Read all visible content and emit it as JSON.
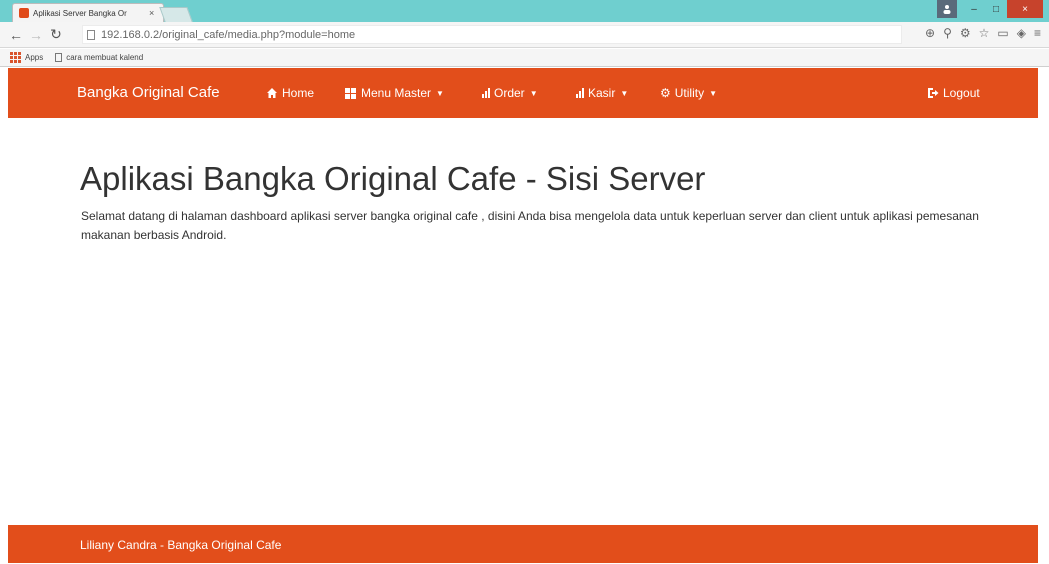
{
  "browser": {
    "tab_title": "Aplikasi Server Bangka Or",
    "tab_close": "×",
    "url": "192.168.0.2/original_cafe/media.php?module=home",
    "win_minimize": "–",
    "win_maximize": "□",
    "win_close": "×",
    "bookmarks": [
      {
        "label": "Apps"
      },
      {
        "label": "cara membuat kalend"
      }
    ]
  },
  "navbar": {
    "brand": "Bangka Original Cafe",
    "items": [
      {
        "label": "Home",
        "icon": "home-icon"
      },
      {
        "label": "Menu Master",
        "icon": "grid-icon",
        "dropdown": true
      },
      {
        "label": "Order",
        "icon": "bar-chart-icon",
        "dropdown": true
      },
      {
        "label": "Kasir",
        "icon": "bar-chart-icon",
        "dropdown": true
      },
      {
        "label": "Utility",
        "icon": "gear-icon",
        "dropdown": true
      }
    ],
    "logout": {
      "label": "Logout",
      "icon": "logout-icon"
    }
  },
  "main": {
    "title": "Aplikasi Bangka Original Cafe - Sisi Server",
    "text": "Selamat datang di halaman dashboard aplikasi server bangka original cafe , disini Anda bisa mengelola data untuk keperluan server dan client untuk aplikasi pemesanan makanan berbasis Android."
  },
  "footer": {
    "text": "Liliany Candra - Bangka Original Cafe"
  },
  "colors": {
    "accent": "#e24e1b",
    "title_bar": "#6fcfcf"
  }
}
